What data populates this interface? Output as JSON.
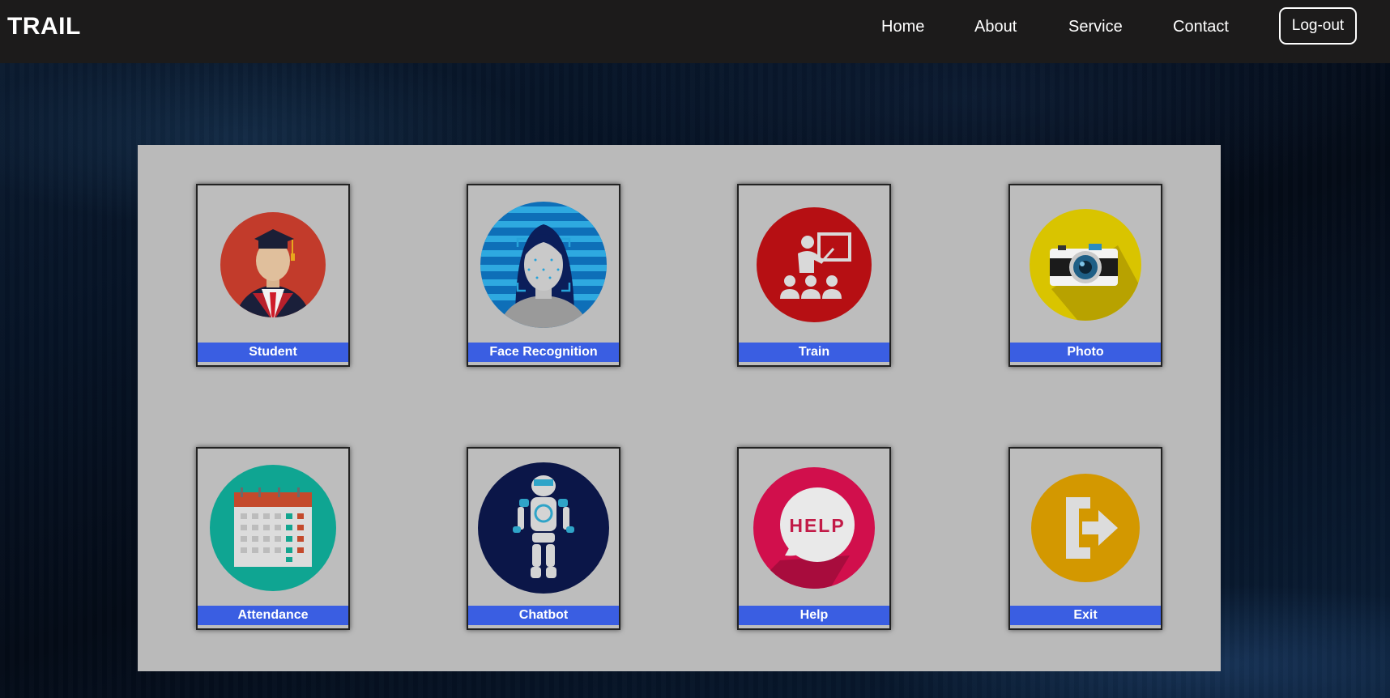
{
  "navbar": {
    "brand": "TRAIL",
    "links": [
      "Home",
      "About",
      "Service",
      "Contact"
    ],
    "logout_label": "Log-out"
  },
  "tiles": [
    {
      "label": "Student",
      "icon": "student-graduate-icon",
      "color": "#c23b2b"
    },
    {
      "label": "Face Recognition",
      "icon": "face-recognition-icon",
      "color": "#1c8bc8"
    },
    {
      "label": "Train",
      "icon": "teacher-board-icon",
      "color": "#b60f13"
    },
    {
      "label": "Photo",
      "icon": "camera-icon",
      "color": "#d9c400"
    },
    {
      "label": "Attendance",
      "icon": "calendar-icon",
      "color": "#0fa592"
    },
    {
      "label": "Chatbot",
      "icon": "robot-icon",
      "color": "#0b1648"
    },
    {
      "label": "Help",
      "icon": "help-bubble-icon",
      "color": "#d10f4c"
    },
    {
      "label": "Exit",
      "icon": "exit-door-icon",
      "color": "#d39800"
    }
  ],
  "colors": {
    "navbar_bg": "#1c1b1b",
    "panel_bg": "#bababa",
    "label_bg": "#3a5ee2"
  }
}
